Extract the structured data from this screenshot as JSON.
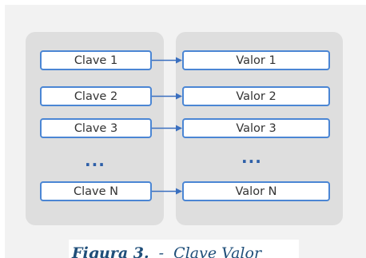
{
  "diagram": {
    "keys": [
      "Clave 1",
      "Clave 2",
      "Clave 3",
      "...",
      "Clave N"
    ],
    "values": [
      "Valor 1",
      "Valor 2",
      "Valor 3",
      "...",
      "Valor N"
    ],
    "key_ellipsis": "...",
    "value_ellipsis": "...",
    "box_border_color": "#4b86d4",
    "arrow_color": "#3a6fbf"
  },
  "caption": {
    "label": "Figura 3.",
    "text": "Clave Valor"
  }
}
